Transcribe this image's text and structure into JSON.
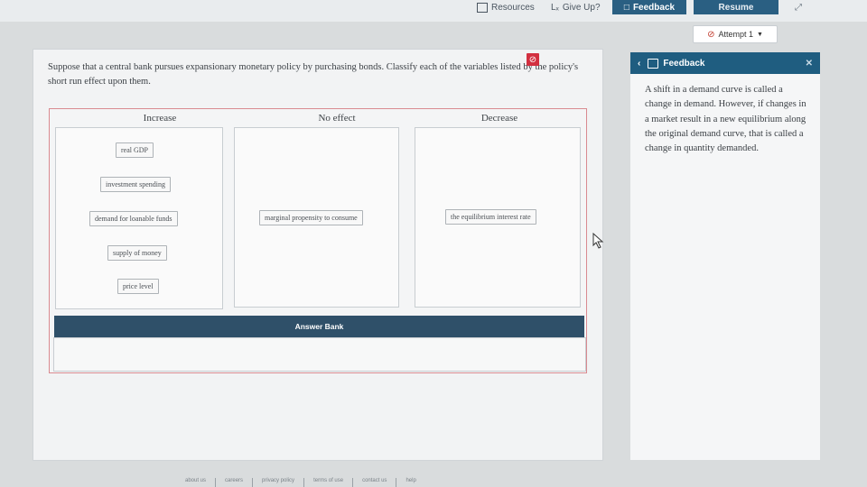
{
  "toolbar": {
    "resources": "Resources",
    "give_up": "Give Up?",
    "feedback": "Feedback",
    "resume": "Resume"
  },
  "attempt": {
    "label": "Attempt 1"
  },
  "question": {
    "text": "Suppose that a central bank pursues expansionary monetary policy by purchasing bonds. Classify each of the variables listed by the policy's short run effect upon them."
  },
  "columns": [
    {
      "header": "Increase",
      "items": [
        "real GDP",
        "investment spending",
        "demand for loanable funds",
        "supply of money",
        "price level"
      ]
    },
    {
      "header": "No effect",
      "items": [
        "marginal propensity to consume"
      ]
    },
    {
      "header": "Decrease",
      "items": [
        "the equilibrium interest rate"
      ]
    }
  ],
  "answer_bank": {
    "label": "Answer Bank"
  },
  "feedback_panel": {
    "title": "Feedback",
    "text": "A shift in a demand curve is called a change in demand. However, if changes in a market result in a new equilibrium along the original demand curve, that is called a change in quantity demanded."
  },
  "footer": [
    "about us",
    "careers",
    "privacy policy",
    "terms of use",
    "contact us",
    "help"
  ]
}
